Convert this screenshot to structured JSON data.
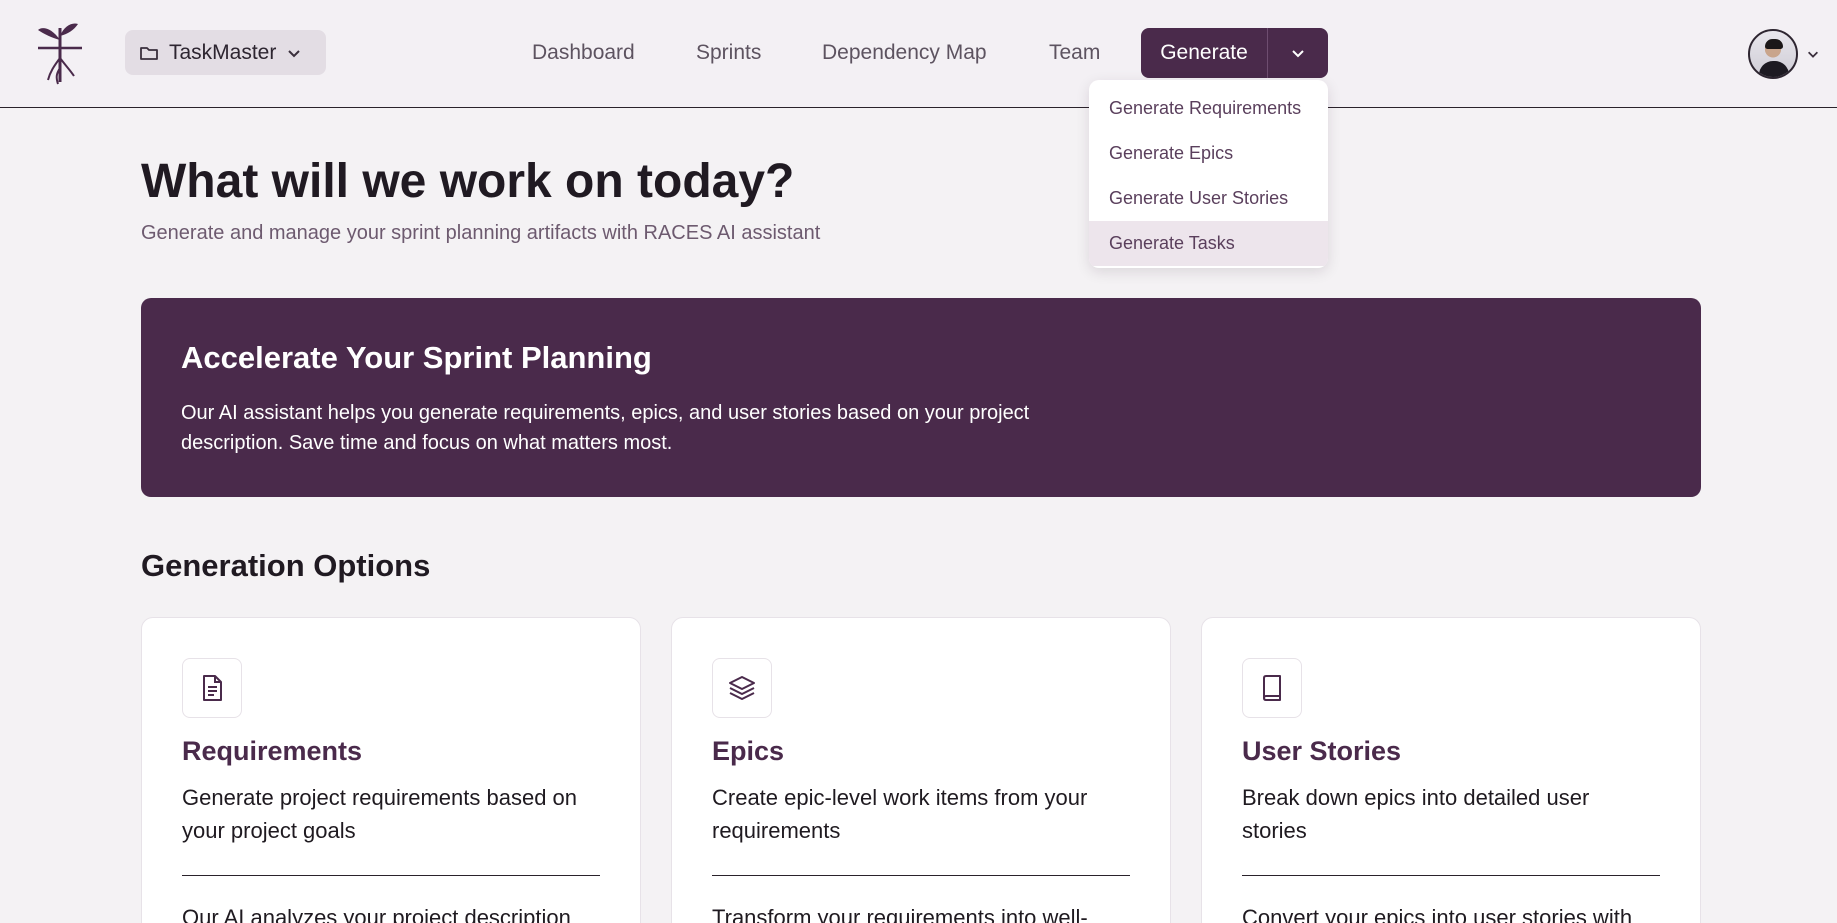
{
  "header": {
    "project_name": "TaskMaster",
    "nav": [
      "Dashboard",
      "Sprints",
      "Dependency Map",
      "Team"
    ],
    "generate_label": "Generate"
  },
  "dropdown": {
    "items": [
      "Generate Requirements",
      "Generate Epics",
      "Generate User Stories",
      "Generate Tasks"
    ],
    "highlighted": "Generate Tasks"
  },
  "main": {
    "title": "What will we work on today?",
    "subtitle": "Generate and manage your sprint planning artifacts with RACES AI assistant",
    "banner_title": "Accelerate Your Sprint Planning",
    "banner_text": "Our AI assistant helps you generate requirements, epics, and user stories based on your project description. Save time and focus on what matters most.",
    "section_title": "Generation Options",
    "cards": [
      {
        "icon": "document-icon",
        "title": "Requirements",
        "description": "Generate project requirements based on your project goals",
        "detail": "Our AI analyzes your project description"
      },
      {
        "icon": "layers-icon",
        "title": "Epics",
        "description": "Create epic-level work items from your requirements",
        "detail": "Transform your requirements into well-"
      },
      {
        "icon": "book-icon",
        "title": "User Stories",
        "description": "Break down epics into detailed user stories",
        "detail": "Convert your epics into user stories with"
      }
    ]
  },
  "colors": {
    "brand": "#4a2a4b",
    "background": "#f4f2f4",
    "header_bg": "#f3f0f4"
  }
}
